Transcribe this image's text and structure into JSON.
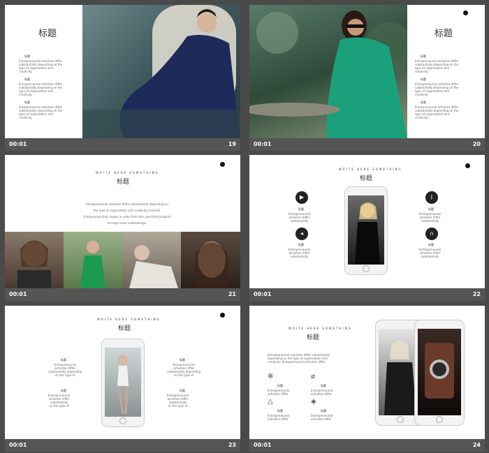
{
  "footer_time": "00:01",
  "slides": {
    "s19": {
      "number": "19",
      "title": "标题",
      "labels": [
        "标题",
        "标题",
        "标题"
      ],
      "text": "Entrepreneurial activities differ\nsubstantially depending on the\ntype of organization and\ncreativity"
    },
    "s20": {
      "number": "20",
      "title": "标题",
      "labels": [
        "标题",
        "标题",
        "标题"
      ],
      "text": "Entrepreneurial activities differ\nsubstantially depending on the\ntype of organization and\ncreativity"
    },
    "s21": {
      "number": "21",
      "tagline": "WRITE HERE SOMETHING",
      "title": "标题",
      "para": "Entrepreneurial  activities  differ  substantially  depending  on\nthe  type  of  organization  and  creativity  involved.\nEntrepreneurship  ranges  in  scale  from  solo,  part-time  projects\nto  large-scale  undertakings."
    },
    "s22": {
      "number": "22",
      "tagline": "WRITE HERE SOMETHING",
      "title": "标题",
      "labels": [
        "标题",
        "标题",
        "标题",
        "标题"
      ],
      "text": "Entrepreneurial\nactivities differ\nsubstantially"
    },
    "s23": {
      "number": "23",
      "tagline": "WRITE HERE SOMETHING",
      "title": "标题",
      "labels": [
        "标题",
        "标题",
        "标题",
        "标题"
      ],
      "text_a": "Entrepreneurial\nactivities differ\nsubstantially depending\non the type of",
      "text_b": "Entrepreneurial\nactivities differ\nsubstantially\non the type of"
    },
    "s24": {
      "number": "24",
      "tagline": "WRITE HERE SOMETHING",
      "title": "标题",
      "labels": [
        "标题",
        "标题",
        "标题",
        "标题"
      ],
      "para": "Entrepreneurial activities differ substantially\ndepending on the type of organization and\ncreativity. Entrepreneurial activities differ",
      "text": "Entrepreneurial\nactivities differ"
    }
  },
  "icons": {
    "s22": [
      "video-icon",
      "bluetooth-icon",
      "speaker-icon",
      "headphones-icon"
    ],
    "s24": [
      "sun-icon",
      "paperclip-icon",
      "bell-icon",
      "layers-icon"
    ]
  }
}
